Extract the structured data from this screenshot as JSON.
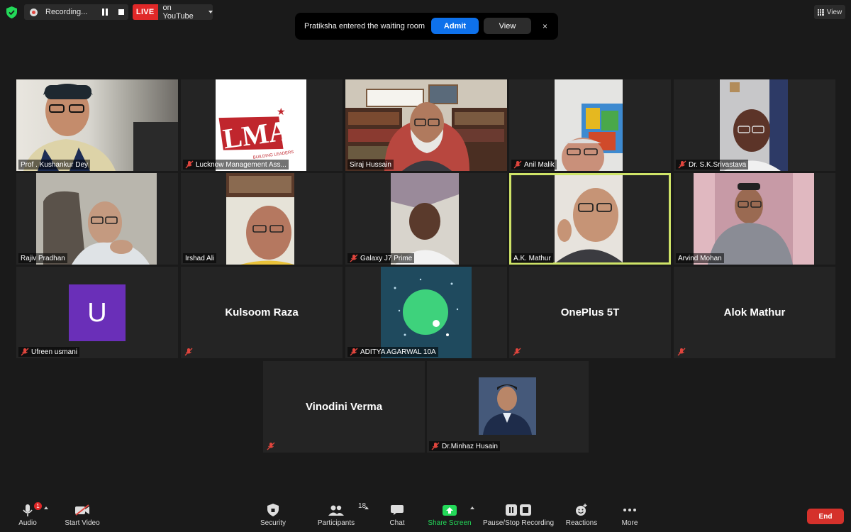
{
  "recording": {
    "label": "Recording..."
  },
  "live": {
    "badge": "LIVE",
    "platform": "on YouTube"
  },
  "notification": {
    "message": "Pratiksha entered the waiting room",
    "admit_label": "Admit",
    "view_label": "View",
    "close_glyph": "×"
  },
  "view_button": {
    "label": "View"
  },
  "participants": [
    {
      "name": "Prof . Kushankur Dey",
      "muted": false,
      "video": true
    },
    {
      "name": "Lucknow Management Ass...",
      "muted": true,
      "video": true,
      "logo": {
        "letters": "LMA",
        "tagline": "BUILDING LEADERS"
      }
    },
    {
      "name": "Siraj Hussain",
      "muted": false,
      "video": true
    },
    {
      "name": "Anil Malik",
      "muted": true,
      "video": true
    },
    {
      "name": "Dr. S.K.Srivastava",
      "muted": true,
      "video": true
    },
    {
      "name": "Rajiv Pradhan",
      "muted": false,
      "video": true
    },
    {
      "name": "Irshad Ali",
      "muted": false,
      "video": true
    },
    {
      "name": "Galaxy J7 Prime",
      "muted": true,
      "video": true
    },
    {
      "name": "A.K. Mathur",
      "muted": false,
      "video": true,
      "active_speaker": true
    },
    {
      "name": "Arvind Mohan",
      "muted": false,
      "video": true
    },
    {
      "name": "Ufreen usmani",
      "muted": true,
      "video": false,
      "avatar_letter": "U",
      "avatar_color": "#6a2fb8"
    },
    {
      "name": "Kulsoom Raza",
      "muted": true,
      "video": false,
      "name_only": true
    },
    {
      "name": "ADITYA AGARWAL 10A",
      "muted": true,
      "video": false,
      "avatar_color": "#1f4a5e"
    },
    {
      "name": "OnePlus 5T",
      "muted": true,
      "video": false,
      "name_only": true
    },
    {
      "name": "Alok Mathur",
      "muted": true,
      "video": false,
      "name_only": true
    },
    {
      "name": "Vinodini Verma",
      "muted": true,
      "video": false,
      "name_only": true
    },
    {
      "name": "Dr.Minhaz Husain",
      "muted": true,
      "video": false,
      "avatar_photo": true
    }
  ],
  "toolbar": {
    "audio": "Audio",
    "audio_badge": "1",
    "start_video": "Start Video",
    "security": "Security",
    "participants": "Participants",
    "participants_count": "18",
    "chat": "Chat",
    "share_screen": "Share Screen",
    "pause_stop_recording": "Pause/Stop Recording",
    "reactions": "Reactions",
    "more": "More",
    "end": "End"
  },
  "colors": {
    "background": "#1a1a1a",
    "tile": "#242424",
    "active_speaker_border": "#cfe468",
    "admit_blue": "#0e71eb",
    "live_red": "#e02828",
    "end_red": "#d5312b",
    "share_green": "#23d959",
    "muted_red": "#e0453d"
  }
}
